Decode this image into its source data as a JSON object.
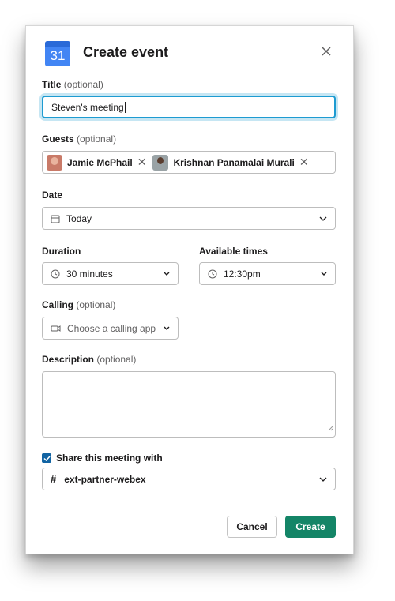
{
  "header": {
    "calendar_day": "31",
    "title": "Create event"
  },
  "title_field": {
    "label": "Title",
    "optional": "(optional)",
    "value": "Steven's meeting"
  },
  "guests_field": {
    "label": "Guests",
    "optional": "(optional)",
    "guests": [
      {
        "name": "Jamie McPhail"
      },
      {
        "name": "Krishnan Panamalai Murali"
      }
    ]
  },
  "date_field": {
    "label": "Date",
    "value": "Today"
  },
  "duration_field": {
    "label": "Duration",
    "value": "30 minutes"
  },
  "times_field": {
    "label": "Available times",
    "value": "12:30pm"
  },
  "calling_field": {
    "label": "Calling",
    "optional": "(optional)",
    "placeholder": "Choose a calling app"
  },
  "description_field": {
    "label": "Description",
    "optional": "(optional)",
    "value": ""
  },
  "share": {
    "label": "Share this meeting with",
    "checked": true,
    "channel": "ext-partner-webex"
  },
  "buttons": {
    "cancel": "Cancel",
    "create": "Create"
  },
  "colors": {
    "primary": "#148567",
    "focus": "#1d9bd1",
    "checkbox": "#1264a3",
    "calendar_blue": "#4285f4"
  }
}
